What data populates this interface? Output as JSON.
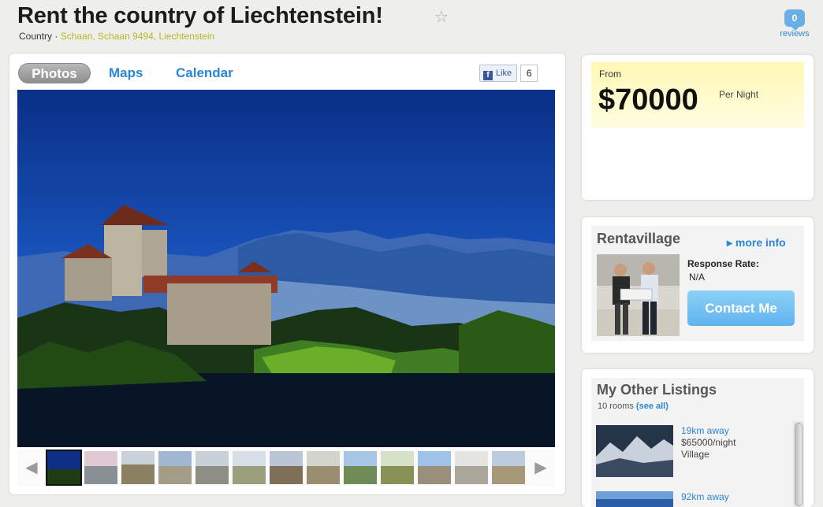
{
  "header": {
    "title": "Rent the country of Liechtenstein!",
    "star_glyph": "☆",
    "crumb_prefix": "Country · ",
    "crumb_location": "Schaan, Schaan 9494, Liechtenstein",
    "reviews_count": "0",
    "reviews_label": "reviews"
  },
  "tabs": [
    {
      "label": "Photos",
      "active": true
    },
    {
      "label": "Maps",
      "active": false
    },
    {
      "label": "Calendar",
      "active": false
    }
  ],
  "facebook": {
    "icon": "f",
    "like_label": "Like",
    "count": "6"
  },
  "gallery": {
    "prev_icon": "◀",
    "next_icon": "▶",
    "main_photo": "castle-mountains-photo",
    "thumbnails": 13
  },
  "price": {
    "from_label": "From",
    "amount": "$70000",
    "unit": "Per Night"
  },
  "owner": {
    "name": "Rentavillage",
    "more_info": "▸ more info",
    "response_label": "Response Rate:",
    "response_value": "N/A",
    "contact_label": "Contact Me"
  },
  "other_listings": {
    "title": "My Other Listings",
    "rooms": "10 rooms ",
    "see_all": "(see all)",
    "items": [
      {
        "distance": "19km away",
        "price": "$65000/night",
        "type": "Village"
      },
      {
        "distance": "92km away",
        "price": "",
        "type": ""
      }
    ]
  },
  "colors": {
    "link_blue": "#2a86d6",
    "location_olive": "#b6b826",
    "price_bg": "#fff8b4",
    "contact_button": "#6ab9f1"
  }
}
